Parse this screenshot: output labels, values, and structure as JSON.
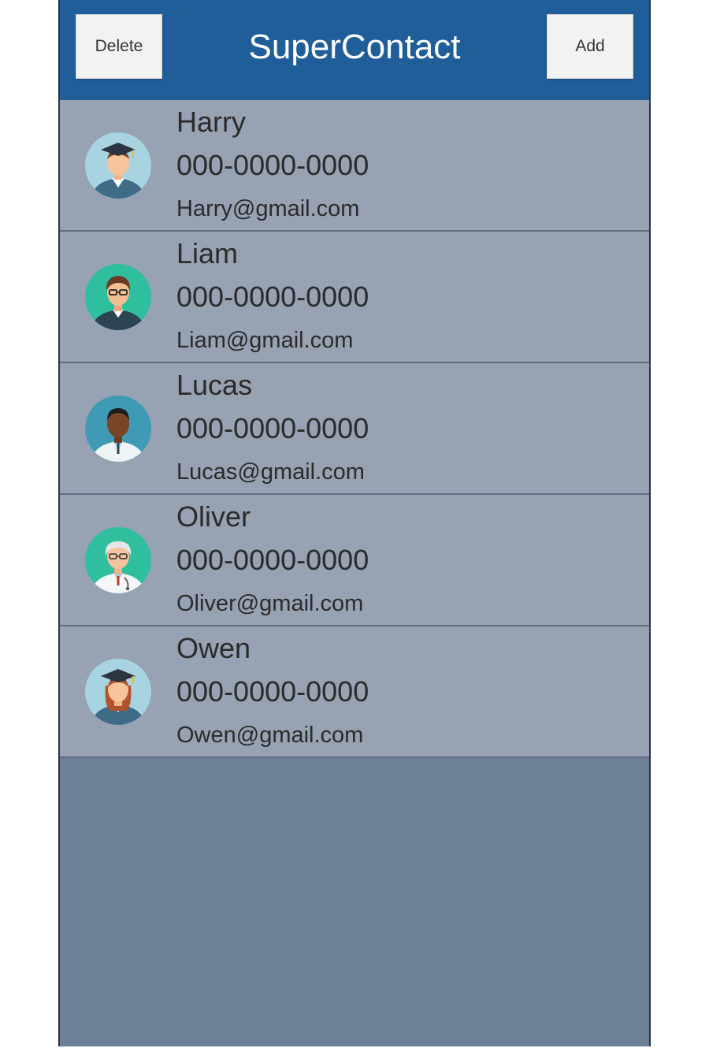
{
  "header": {
    "title": "SuperContact",
    "delete_label": "Delete",
    "add_label": "Add"
  },
  "colors": {
    "header_bg": "#1f5e99",
    "row_bg": "#97a2b2",
    "empty_bg": "#6e7f98",
    "button_bg": "#f2f2f2"
  },
  "contacts": [
    {
      "name": "Harry",
      "phone": "000-0000-0000",
      "email": "Harry@gmail.com",
      "avatar": "graduate-male-avatar-icon"
    },
    {
      "name": "Liam",
      "phone": "000-0000-0000",
      "email": "Liam@gmail.com",
      "avatar": "man-glasses-avatar-icon"
    },
    {
      "name": "Lucas",
      "phone": "000-0000-0000",
      "email": "Lucas@gmail.com",
      "avatar": "doctor-male-avatar-icon"
    },
    {
      "name": "Oliver",
      "phone": "000-0000-0000",
      "email": "Oliver@gmail.com",
      "avatar": "senior-doctor-avatar-icon"
    },
    {
      "name": "Owen",
      "phone": "000-0000-0000",
      "email": "Owen@gmail.com",
      "avatar": "graduate-female-avatar-icon"
    }
  ]
}
